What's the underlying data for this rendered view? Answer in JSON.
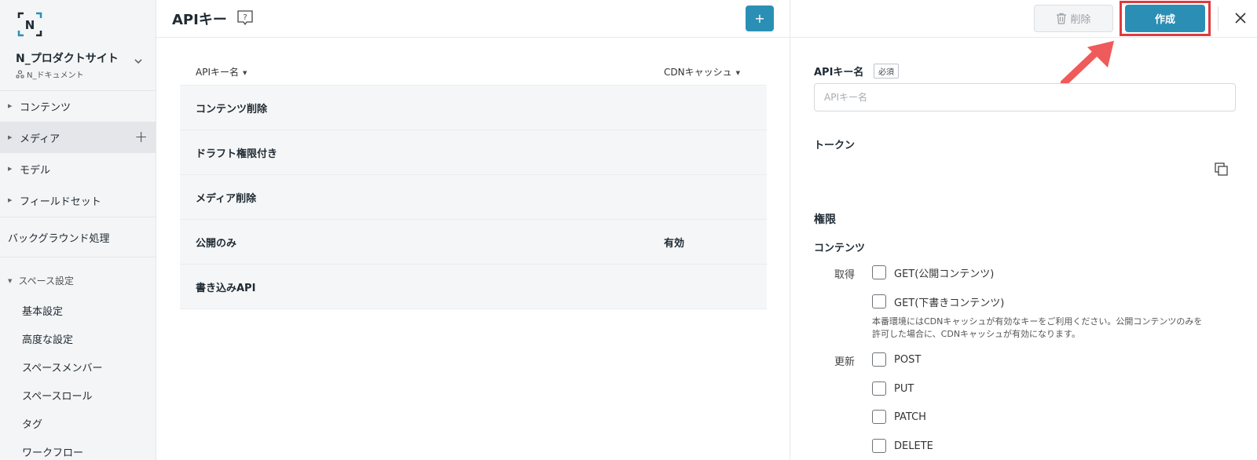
{
  "sidebar": {
    "logo_letter": "N",
    "site_name": "N_プロダクトサイト",
    "site_sub": "N_ドキュメント",
    "nav": [
      {
        "label": "コンテンツ"
      },
      {
        "label": "メディア"
      },
      {
        "label": "モデル"
      },
      {
        "label": "フィールドセット"
      }
    ],
    "background_label": "バックグラウンド処理",
    "space_section_label": "スペース設定",
    "space_items": [
      "基本設定",
      "高度な設定",
      "スペースメンバー",
      "スペースロール",
      "タグ",
      "ワークフロー"
    ]
  },
  "header": {
    "title": "APIキー",
    "help_symbol": "?",
    "add_symbol": "+"
  },
  "table": {
    "columns": [
      "APIキー名",
      "CDNキャッシュ"
    ],
    "rows": [
      {
        "name": "コンテンツ削除",
        "cdn": ""
      },
      {
        "name": "ドラフト権限付き",
        "cdn": ""
      },
      {
        "name": "メディア削除",
        "cdn": ""
      },
      {
        "name": "公開のみ",
        "cdn": "有効"
      },
      {
        "name": "書き込みAPI",
        "cdn": ""
      }
    ]
  },
  "panel": {
    "delete_label": "削除",
    "create_label": "作成",
    "close_symbol": "✕",
    "api_key_name_label": "APIキー名",
    "required_badge": "必須",
    "api_key_placeholder": "APIキー名",
    "token_label": "トークン",
    "permissions_title": "権限",
    "contents_label": "コンテンツ",
    "get_label": "取得",
    "update_label": "更新",
    "checkboxes": {
      "get_public": "GET(公開コンテンツ)",
      "get_draft": "GET(下書きコンテンツ)",
      "post": "POST",
      "put": "PUT",
      "patch": "PATCH",
      "delete": "DELETE"
    },
    "cdn_note_line1": "本番環境にはCDNキャッシュが有効なキーをご利用ください。公開コンテンツのみを",
    "cdn_note_line2": "許可した場合に、CDNキャッシュが有効になります。"
  },
  "colors": {
    "accent": "#2b8fb5",
    "highlight": "#e03a3e",
    "arrow": "#ef5a5a"
  },
  "icons": [
    "logo-icon",
    "user-group-icon",
    "chevron-down-icon",
    "caret-right-icon",
    "plus-icon",
    "help-icon",
    "trash-icon",
    "close-icon",
    "copy-icon",
    "caret-down-icon",
    "arrow-icon"
  ]
}
